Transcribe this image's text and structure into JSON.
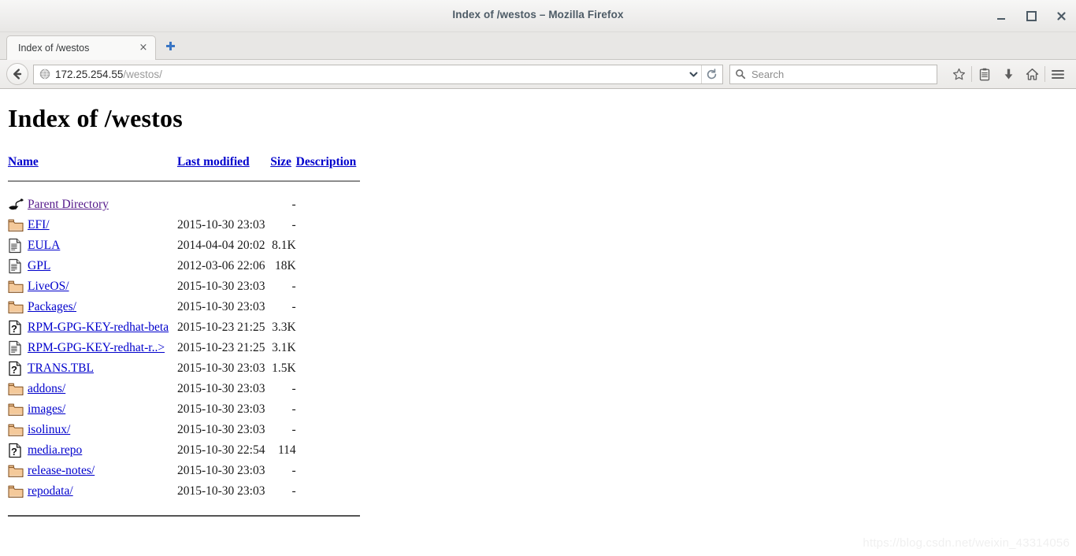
{
  "window": {
    "title": "Index of /westos – Mozilla Firefox",
    "controls": {
      "minimize": "minimize-icon",
      "maximize": "maximize-icon",
      "close": "close-icon"
    }
  },
  "tabs": [
    {
      "label": "Index of /westos",
      "close": "×"
    }
  ],
  "newtab": {
    "label": "+"
  },
  "navbar": {
    "back": "back-arrow-icon",
    "url_domain": "172.25.254.55",
    "url_path": "/westos/",
    "dropdown": "chevron-down-icon",
    "reload": "reload-icon",
    "search_placeholder": "Search",
    "icons": [
      "bookmark-star-icon",
      "reader-list-icon",
      "download-arrow-icon",
      "home-icon",
      "hamburger-menu-icon"
    ]
  },
  "page": {
    "title": "Index of /westos",
    "columns": [
      {
        "key": "name",
        "label": "Name"
      },
      {
        "key": "date",
        "label": "Last modified"
      },
      {
        "key": "size",
        "label": "Size"
      },
      {
        "key": "desc",
        "label": "Description"
      }
    ],
    "rows": [
      {
        "icon": "parent-directory-icon",
        "name": "Parent Directory",
        "visited": true,
        "date": "",
        "size": "-",
        "desc": ""
      },
      {
        "icon": "folder-icon",
        "name": "EFI/",
        "date": "2015-10-30 23:03",
        "size": "-",
        "desc": ""
      },
      {
        "icon": "text-file-icon",
        "name": "EULA",
        "date": "2014-04-04 20:02",
        "size": "8.1K",
        "desc": ""
      },
      {
        "icon": "text-file-icon",
        "name": "GPL",
        "date": "2012-03-06 22:06",
        "size": "18K",
        "desc": ""
      },
      {
        "icon": "folder-icon",
        "name": "LiveOS/",
        "date": "2015-10-30 23:03",
        "size": "-",
        "desc": ""
      },
      {
        "icon": "folder-icon",
        "name": "Packages/",
        "date": "2015-10-30 23:03",
        "size": "-",
        "desc": ""
      },
      {
        "icon": "unknown-file-icon",
        "name": "RPM-GPG-KEY-redhat-beta",
        "date": "2015-10-23 21:25",
        "size": "3.3K",
        "desc": ""
      },
      {
        "icon": "text-file-icon",
        "name": "RPM-GPG-KEY-redhat-r..>",
        "date": "2015-10-23 21:25",
        "size": "3.1K",
        "desc": ""
      },
      {
        "icon": "unknown-file-icon",
        "name": "TRANS.TBL",
        "date": "2015-10-30 23:03",
        "size": "1.5K",
        "desc": ""
      },
      {
        "icon": "folder-icon",
        "name": "addons/",
        "date": "2015-10-30 23:03",
        "size": "-",
        "desc": ""
      },
      {
        "icon": "folder-icon",
        "name": "images/",
        "date": "2015-10-30 23:03",
        "size": "-",
        "desc": ""
      },
      {
        "icon": "folder-icon",
        "name": "isolinux/",
        "date": "2015-10-30 23:03",
        "size": "-",
        "desc": ""
      },
      {
        "icon": "unknown-file-icon",
        "name": "media.repo",
        "date": "2015-10-30 22:54",
        "size": "114",
        "desc": ""
      },
      {
        "icon": "folder-icon",
        "name": "release-notes/",
        "date": "2015-10-30 23:03",
        "size": "-",
        "desc": ""
      },
      {
        "icon": "folder-icon",
        "name": "repodata/",
        "date": "2015-10-30 23:03",
        "size": "-",
        "desc": ""
      }
    ]
  },
  "watermark": "https://blog.csdn.net/weixin_43314056",
  "colors": {
    "link": "#0000cc",
    "visited_link": "#551a8b",
    "chrome_bg": "#e8e7e5",
    "title_text": "#4d5b66",
    "folder_fill": "#f4c99a",
    "folder_stroke": "#8a5a2b",
    "accent_blue": "#3a76c4"
  }
}
